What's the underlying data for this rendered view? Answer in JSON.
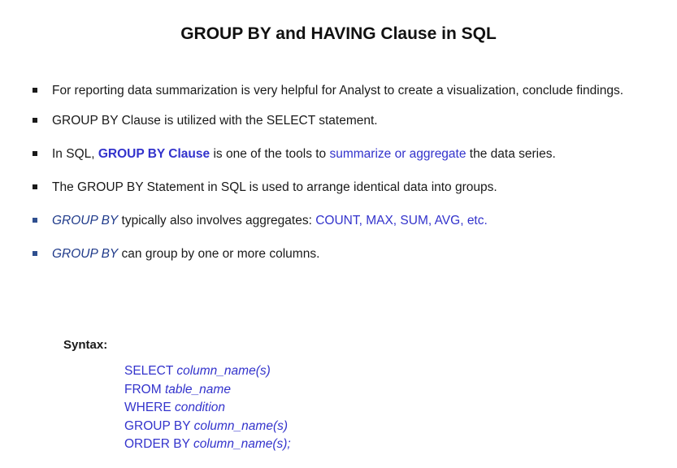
{
  "title": "GROUP BY and HAVING Clause in SQL",
  "bullets": {
    "b1": "For reporting data summarization is very helpful for Analyst to create a visualization, conclude findings.",
    "b2": "GROUP BY Clause is utilized with the SELECT statement.",
    "b3": {
      "pre": "In SQL, ",
      "keyword": "GROUP BY Clause",
      "mid": " is one of the tools to ",
      "highlight": "summarize or aggregate",
      "post": " the data series."
    },
    "b4": "The GROUP BY Statement in SQL is used to arrange identical data into groups.",
    "b5": {
      "keyword": "GROUP BY",
      "mid": " typically also involves aggregates: ",
      "highlight": "COUNT, MAX, SUM, AVG, etc."
    },
    "b6": {
      "keyword": "GROUP BY",
      "post": " can group by one or more columns."
    }
  },
  "syntax": {
    "label": "Syntax",
    "colon": ":",
    "lines": [
      {
        "kw": "SELECT ",
        "arg": "column_name(s)"
      },
      {
        "kw": "FROM ",
        "arg": "table_name"
      },
      {
        "kw": "WHERE ",
        "arg": "condition"
      },
      {
        "kw": "GROUP BY ",
        "arg": "column_name(s)"
      },
      {
        "kw": "ORDER BY ",
        "arg": "column_name(s);"
      }
    ]
  },
  "colors": {
    "accent_blue": "#3333cc",
    "navy_italic": "#1f3a8a",
    "text": "#1a1a1a"
  }
}
